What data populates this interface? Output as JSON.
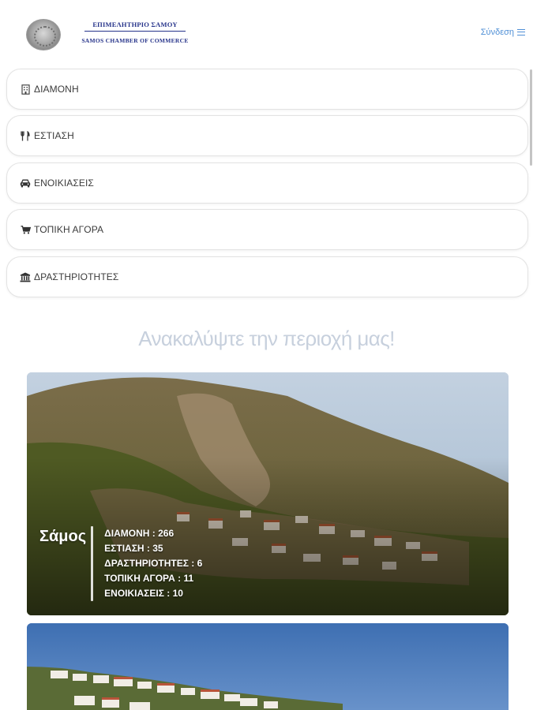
{
  "header": {
    "logo_text_gr": "ΕΠΙΜΕΛΗΤΗΡΙΟ ΣΑΜΟΥ",
    "logo_text_en": "SAMOS CHAMBER OF COMMERCE",
    "login_label": "Σύνδεση",
    "menu_icon": "hamburger-icon"
  },
  "categories": [
    {
      "label": "ΔΙΑΜΟΝΗ",
      "icon": "building-icon"
    },
    {
      "label": "ΕΣΤΙΑΣΗ",
      "icon": "fork-knife-icon"
    },
    {
      "label": "ΕΝΟΙΚΙΑΣΕΙΣ",
      "icon": "car-icon"
    },
    {
      "label": "ΤΟΠΙΚΗ ΑΓΟΡΑ",
      "icon": "cart-icon"
    },
    {
      "label": "ΔΡΑΣΤΗΡΙΟΤΗΤΕΣ",
      "icon": "landmark-icon"
    }
  ],
  "discover_heading": "Ανακαλύψτε την περιοχή μας!",
  "cards": [
    {
      "place": "Σάμος",
      "stats": [
        "ΔΙΑΜΟΝΗ : 266",
        "ΕΣΤΙΑΣΗ : 35",
        "ΔΡΑΣΤΗΡΙΟΤΗΤΕΣ : 6",
        "ΤΟΠΙΚΗ ΑΓΟΡΑ : 11",
        "ΕΝΟΙΚΙΑΣΕΙΣ : 10"
      ]
    }
  ],
  "colors": {
    "accent": "#4f8fd6",
    "logo_blue": "#26338a",
    "heading": "#c7d0dd"
  }
}
